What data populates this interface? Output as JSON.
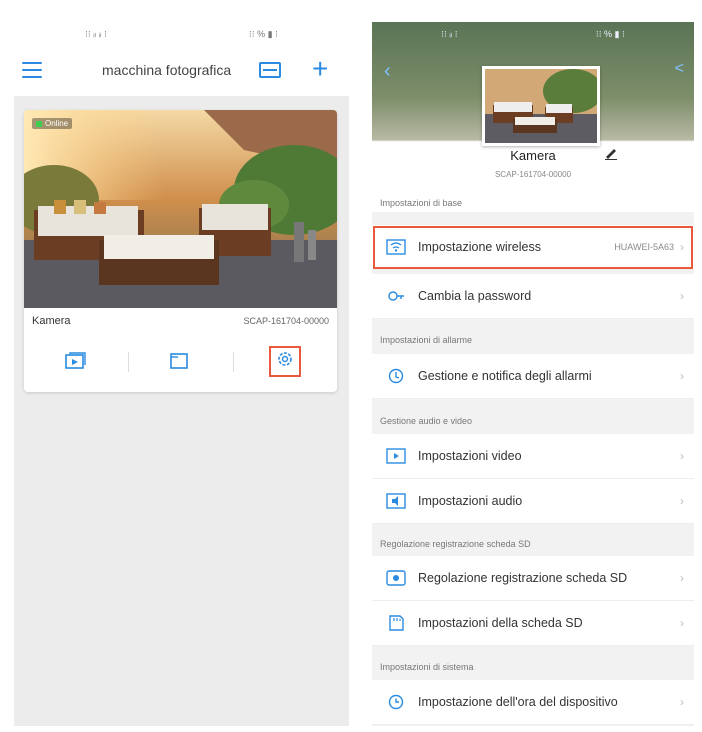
{
  "left": {
    "status_left": "⁝⁝ ᵢₗ ᵢₗ ⁝",
    "status_right": "⁝⁝ % ▮ ⁝",
    "title": "macchina fotografica",
    "card": {
      "online_label": "Online",
      "name": "Kamera",
      "uid": "SCAP-161704-00000"
    }
  },
  "right": {
    "status_left": "⁝⁝ ᵢₗ ⁝",
    "status_right": "⁝⁝ % ▮ ⁝",
    "device_name": "Kamera",
    "device_uid": "SCAP-161704-00000",
    "sections": [
      {
        "title": "Impostazioni di base",
        "rows": [
          {
            "label": "Impostazione wireless",
            "value": "HUAWEI-5A63",
            "icon": "wifi-icon"
          },
          {
            "label": "Cambia la password",
            "value": "",
            "icon": "key-icon"
          }
        ]
      },
      {
        "title": "Impostazioni di allarme",
        "rows": [
          {
            "label": "Gestione e notifica degli allarmi",
            "value": "",
            "icon": "alarm-icon"
          }
        ]
      },
      {
        "title": "Gestione audio e video",
        "rows": [
          {
            "label": "Impostazioni video",
            "value": "",
            "icon": "video-icon"
          },
          {
            "label": "Impostazioni audio",
            "value": "",
            "icon": "audio-icon"
          }
        ]
      },
      {
        "title": "Regolazione registrazione scheda SD",
        "rows": [
          {
            "label": "Regolazione registrazione scheda SD",
            "value": "",
            "icon": "record-icon"
          },
          {
            "label": "Impostazioni della scheda SD",
            "value": "",
            "icon": "sd-card-icon"
          }
        ]
      },
      {
        "title": "Impostazioni di sistema",
        "rows": [
          {
            "label": "Impostazione dell'ora del dispositivo",
            "value": "",
            "icon": "clock-icon"
          }
        ]
      }
    ]
  },
  "colors": {
    "accent": "#2a8be0",
    "highlight": "#e85a3e",
    "online": "#3fcf4f"
  }
}
